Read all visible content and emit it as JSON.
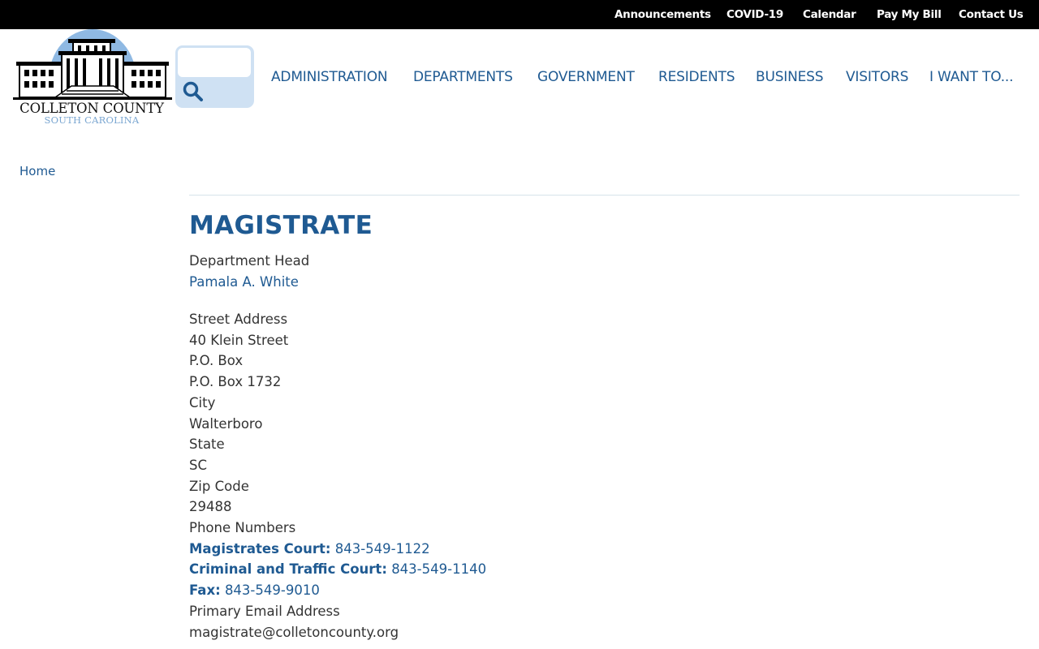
{
  "topbar": {
    "links": [
      "Announcements",
      "COVID-19",
      "Calendar",
      "Pay My Bill",
      "Contact Us"
    ]
  },
  "logo": {
    "line1": "COLLETON COUNTY",
    "line2": "SOUTH CAROLINA"
  },
  "search": {
    "placeholder": "",
    "icon": "search-icon"
  },
  "nav": {
    "items": [
      "ADMINISTRATION",
      "DEPARTMENTS",
      "GOVERNMENT",
      "RESIDENTS",
      "BUSINESS",
      "VISITORS",
      "I WANT TO..."
    ]
  },
  "breadcrumb": {
    "home": "Home"
  },
  "page": {
    "title": "MAGISTRATE",
    "department_head_label": "Department Head",
    "department_head_name": "Pamala A. White",
    "street_address_label": "Street Address",
    "street_address": "40 Klein Street",
    "po_box_label": "P.O. Box",
    "po_box": "P.O. Box 1732",
    "city_label": "City",
    "city": "Walterboro",
    "state_label": "State",
    "state": "SC",
    "zip_label": "Zip Code",
    "zip": "29488",
    "phone_label": "Phone Numbers",
    "phones": [
      {
        "label": "Magistrates Court:",
        "number": "843-549-1122"
      },
      {
        "label": "Criminal and Traffic Court:",
        "number": "843-549-1140"
      },
      {
        "label": "Fax:",
        "number": "843-549-9010"
      }
    ],
    "email_label": "Primary Email Address",
    "email": "magistrate@colletoncounty.org"
  },
  "colors": {
    "brand_blue": "#1f5a92",
    "topbar_bg": "#000000",
    "search_bg": "#cfe1f3"
  }
}
